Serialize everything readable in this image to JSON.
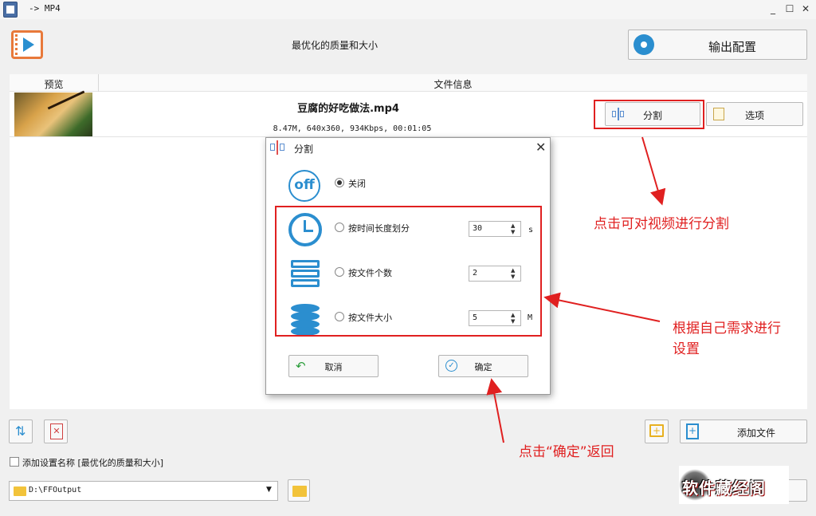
{
  "window": {
    "title": "-> MP4",
    "minimize": "_",
    "maximize": "☐",
    "close": "✕"
  },
  "header": {
    "title": "最优化的质量和大小",
    "output_button": "输出配置"
  },
  "list": {
    "col_preview": "预览",
    "col_info": "文件信息",
    "file": {
      "name": "豆腐的好吃做法.mp4",
      "meta": "8.47M, 640x360, 934Kbps, 00:01:05"
    },
    "split_button": "分割",
    "options_button": "选项"
  },
  "dialog": {
    "title": "分割",
    "off_icon_text": "off",
    "options": [
      {
        "label": "关闭",
        "selected": true
      },
      {
        "label": "按时间长度划分",
        "selected": false,
        "value": "30",
        "unit": "s"
      },
      {
        "label": "按文件个数",
        "selected": false,
        "value": "2",
        "unit": ""
      },
      {
        "label": "按文件大小",
        "selected": false,
        "value": "5",
        "unit": "M"
      }
    ],
    "cancel": "取消",
    "ok": "确定"
  },
  "bottom": {
    "checkbox_label": "添加设置名称 [最优化的质量和大小]",
    "path": "D:\\FFOutput",
    "add_file": "添加文件"
  },
  "annotations": {
    "split_hint": "点击可对视频进行分割",
    "settings_hint_line1": "根据自己需求进行",
    "settings_hint_line2": "设置",
    "ok_hint": "点击“确定”返回",
    "watermark": "软件藏经阁"
  },
  "colors": {
    "accent": "#2b8ecf",
    "annotation": "#e02020",
    "logo_orange": "#e8793a"
  }
}
